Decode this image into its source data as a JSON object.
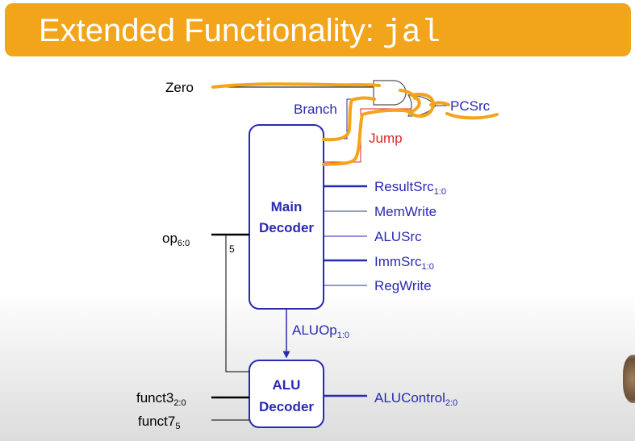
{
  "slide": {
    "title": "Extended Functionality:",
    "title_code": "jal"
  },
  "diagram": {
    "main_decoder": {
      "line1": "Main",
      "line2": "Decoder"
    },
    "alu_decoder": {
      "line1": "ALU",
      "line2": "Decoder"
    },
    "signals": {
      "zero": "Zero",
      "branch": "Branch",
      "jump": "Jump",
      "pcsrc": "PCSrc",
      "op": {
        "base": "op",
        "sub": "6:0"
      },
      "op_tap": "5",
      "resultsrc": {
        "base": "ResultSrc",
        "sub": "1:0"
      },
      "memwrite": "MemWrite",
      "alusrc": "ALUSrc",
      "immsrc": {
        "base": "ImmSrc",
        "sub": "1:0"
      },
      "regwrite": "RegWrite",
      "aluop": {
        "base": "ALUOp",
        "sub": "1:0"
      },
      "funct3": {
        "base": "funct3",
        "sub": "2:0"
      },
      "funct7": {
        "base": "funct7",
        "sub": "5"
      },
      "alucontrol": {
        "base": "ALUControl",
        "sub": "2:0"
      }
    },
    "colors": {
      "signal_blue": "#2a2ab0",
      "jump_red": "#d42a2a",
      "highlight_orange": "#f5a31a",
      "title_bar": "#f2a51a"
    }
  }
}
